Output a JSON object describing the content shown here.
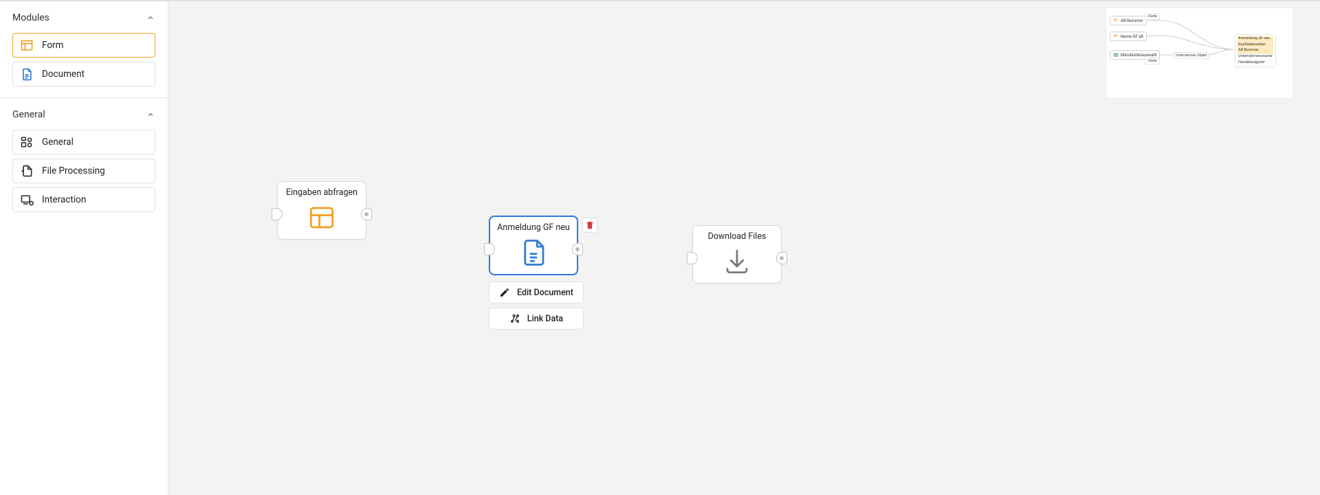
{
  "sidebar": {
    "sections": {
      "modules": {
        "title": "Modules",
        "items": [
          {
            "label": "Form"
          },
          {
            "label": "Document"
          }
        ]
      },
      "general": {
        "title": "General",
        "items": [
          {
            "label": "General"
          },
          {
            "label": "File Processing"
          },
          {
            "label": "Interaction"
          }
        ]
      }
    }
  },
  "canvas": {
    "nodes": {
      "n1": {
        "title": "Eingaben abfragen",
        "type": "form"
      },
      "n2": {
        "title": "Anmeldung GF neu",
        "type": "document",
        "selected": true
      },
      "n3": {
        "title": "Download Files",
        "type": "download"
      }
    },
    "actions": {
      "edit": "Edit Document",
      "link": "Link Data"
    }
  },
  "minimap": {
    "nodes": [
      {
        "label": "AR-Nummer",
        "type": "text"
      },
      {
        "label": "Name GF alt",
        "type": "text"
      },
      {
        "label": "Mandantenauswahl",
        "type": "select"
      }
    ],
    "pills": [
      "+Seite",
      "+Seite",
      "Unternehmen Objekt"
    ],
    "card": {
      "rows": [
        "Anmeldung GF neu",
        "Kaufdatenseiten",
        "AR-Nummer",
        "Unternehmensname",
        "Handelsregister"
      ]
    }
  }
}
